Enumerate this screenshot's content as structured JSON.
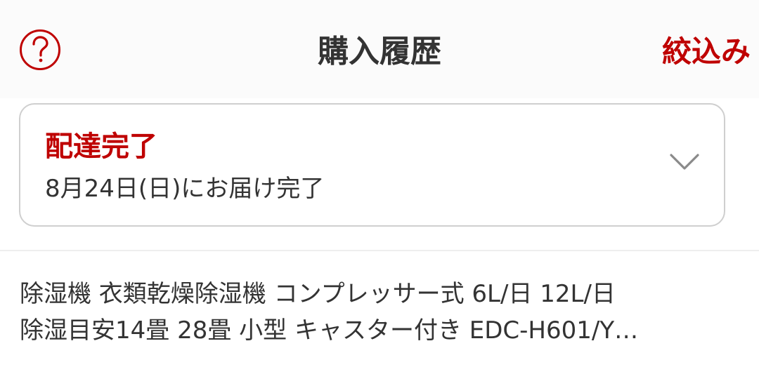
{
  "header": {
    "help_icon": "question-circle-icon",
    "title": "購入履歴",
    "filter_label": "絞込み"
  },
  "status_card": {
    "status": "配達完了",
    "detail": "8月24日(日)にお届け完了",
    "expand_icon": "chevron-down-icon"
  },
  "product": {
    "name_line1": "除湿機 衣類乾燥除湿機 コンプレッサー式 6L/日 12L/日",
    "name_line2": "除湿目安14畳 28畳 小型 キャスター付き EDC-H601/Y…"
  },
  "colors": {
    "accent": "#bf0000",
    "text": "#333333",
    "border": "#cfcfcf"
  }
}
